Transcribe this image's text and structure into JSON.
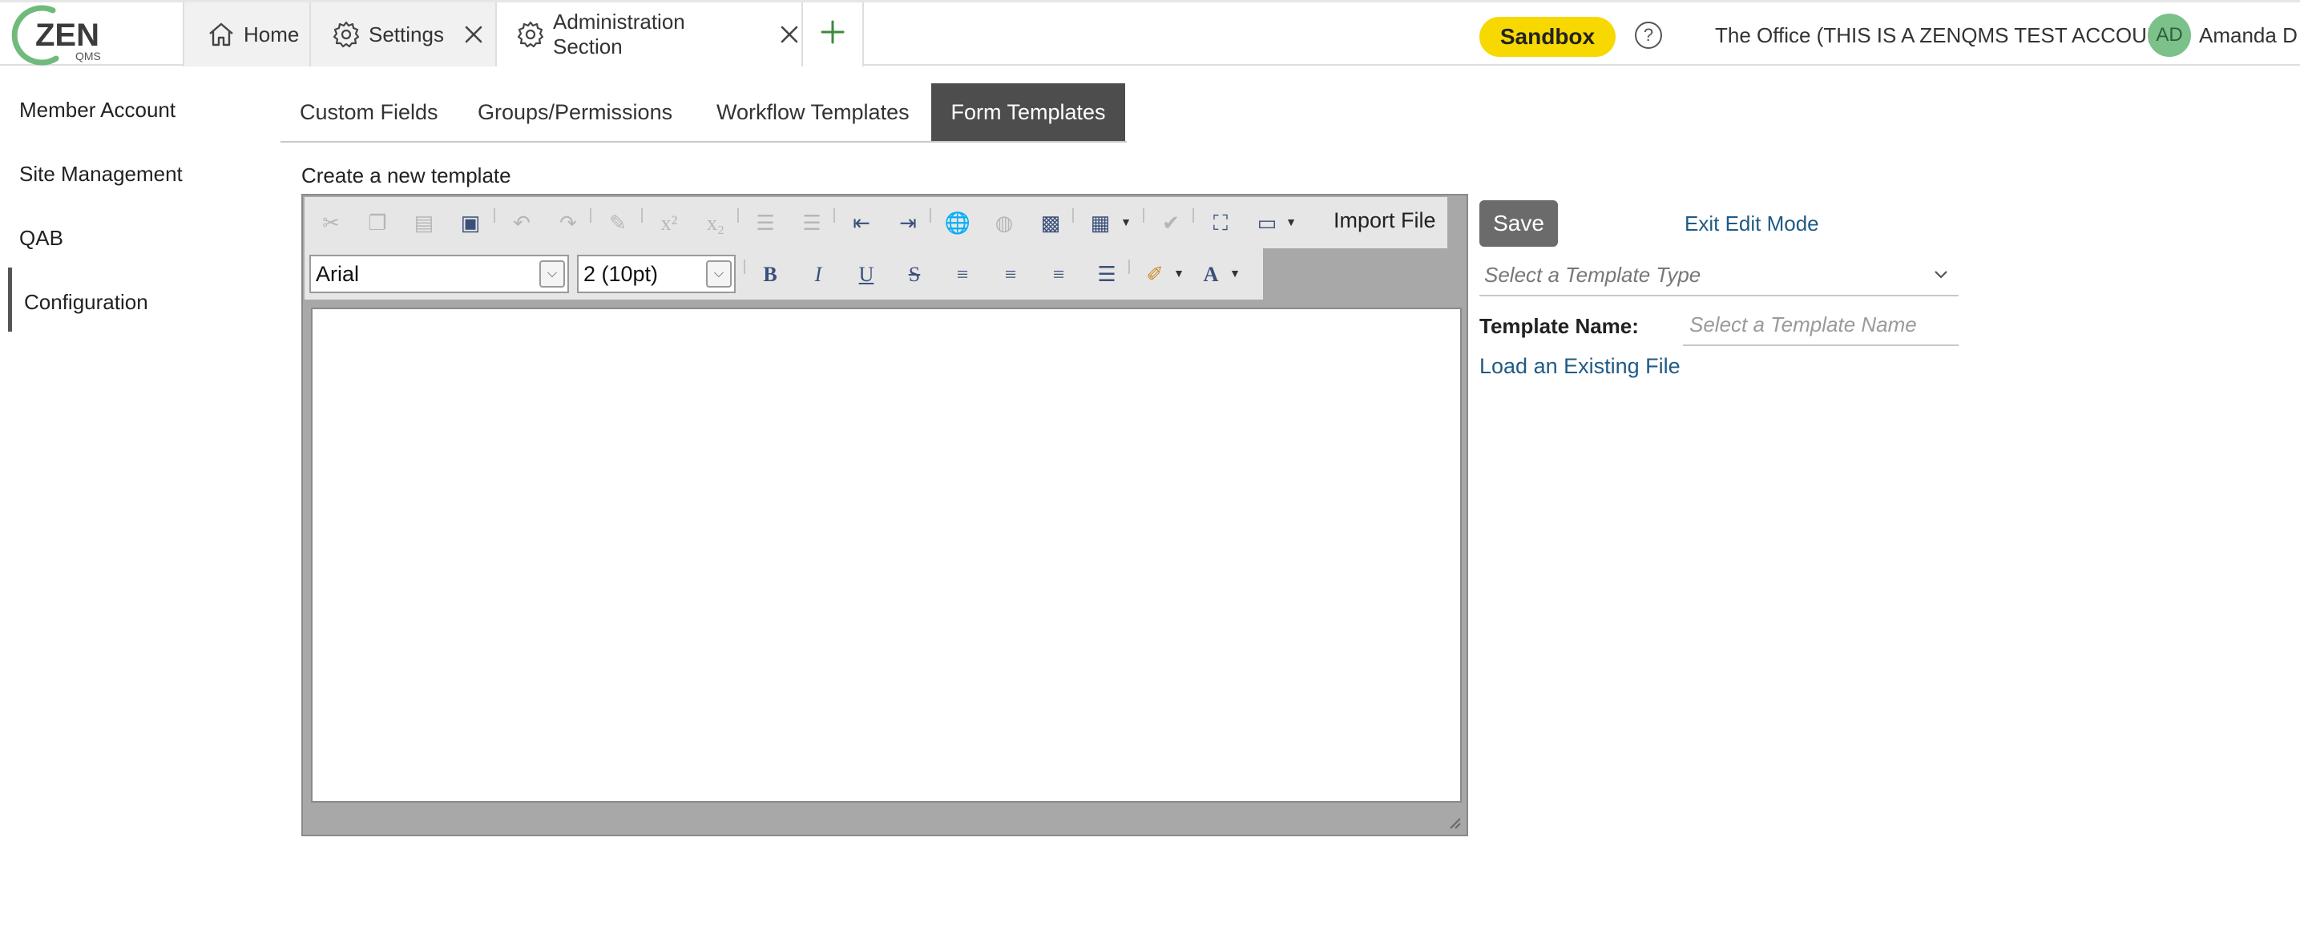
{
  "header": {
    "logo_text": "ZEN",
    "logo_subtext": "QMS",
    "tabs": [
      {
        "label": "Home",
        "icon": "home-icon"
      },
      {
        "label": "Settings",
        "icon": "gear-icon"
      },
      {
        "label": "Administration Section",
        "icon": "gear-icon"
      }
    ],
    "sandbox_label": "Sandbox",
    "help_symbol": "?",
    "account_name": "The Office (THIS IS A ZENQMS TEST ACCOUNT)",
    "user_initials": "AD",
    "user_name": "Amanda D",
    "colors": {
      "sandbox": "#f7d800",
      "avatar": "#7cc08a",
      "link": "#1f5a86",
      "active_tab": "#4d4d4d"
    }
  },
  "sidebar": {
    "items": [
      {
        "label": "Member Account"
      },
      {
        "label": "Site Management"
      },
      {
        "label": "QAB"
      },
      {
        "label": "Configuration",
        "active": true
      }
    ]
  },
  "subtabs": [
    {
      "label": "Custom Fields"
    },
    {
      "label": "Groups/Permissions"
    },
    {
      "label": "Workflow Templates"
    },
    {
      "label": "Form Templates",
      "active": true
    }
  ],
  "editor": {
    "create_label": "Create a new template",
    "import_label": "Import File",
    "font_value": "Arial",
    "size_value": "2 (10pt)",
    "superscript": "x²",
    "subscript": "x₂"
  },
  "panel": {
    "save_label": "Save",
    "exit_label": "Exit Edit Mode",
    "type_placeholder": "Select a Template Type",
    "name_label": "Template Name:",
    "name_placeholder": "Select a Template Name",
    "load_label": "Load an Existing File"
  }
}
